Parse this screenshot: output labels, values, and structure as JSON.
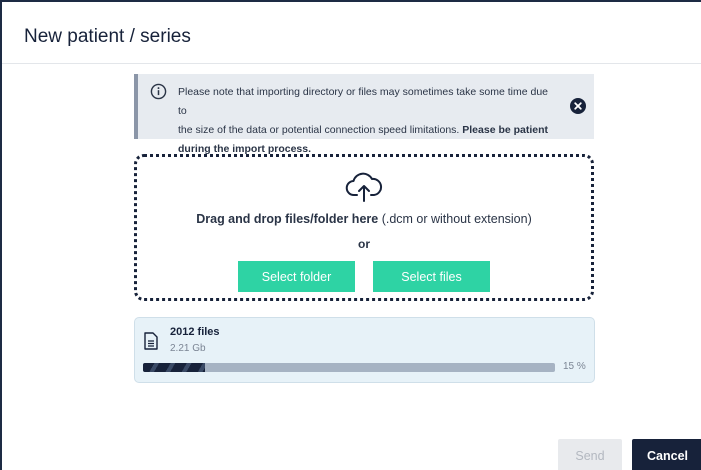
{
  "dialog": {
    "title": "New patient / series"
  },
  "notice": {
    "icon": "info-icon",
    "text_line1": "Please note that importing directory or files may sometimes take some time due to",
    "text_line2a": "the size of the data or potential connection speed limitations. ",
    "text_line2b": "Please be patient",
    "text_line3": "during the import process.",
    "close_icon": "close-circle-icon"
  },
  "dropzone": {
    "icon": "cloud-upload-icon",
    "text_bold": "Drag and drop files/folder here",
    "text_rest": " (.dcm or without extension)",
    "or_label": "or",
    "select_folder_label": "Select folder",
    "select_files_label": "Select files",
    "button_color": "#2ed3a4"
  },
  "upload": {
    "icon": "file-icon",
    "file_count": "2012 files",
    "size": "2.21 Gb",
    "progress_percent": 15,
    "progress_label": "15 %"
  },
  "footer": {
    "send_label": "Send",
    "cancel_label": "Cancel",
    "cancel_color": "#17223a"
  }
}
